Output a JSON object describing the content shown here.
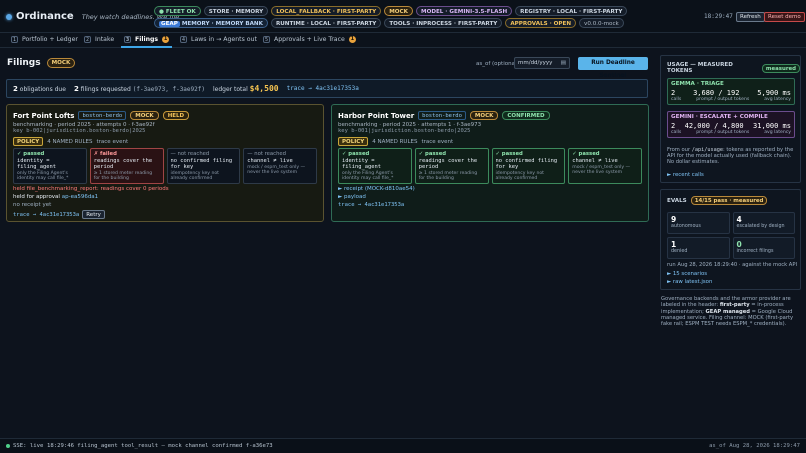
{
  "brand": {
    "name": "Ordinance",
    "tagline": "They watch deadlines. We file."
  },
  "chips_row1": [
    {
      "label": "● FLEET OK",
      "kind": "ok"
    },
    {
      "label": "STORE · MEMORY",
      "kind": "plain"
    },
    {
      "label": "LOCAL_FALLBACK · FIRST-PARTY",
      "kind": "warn"
    },
    {
      "label": "MOCK",
      "kind": "mock"
    },
    {
      "label": "MODEL · GEMINI-3.5-FLASH",
      "kind": "model"
    },
    {
      "label": "REGISTRY · LOCAL · FIRST-PARTY",
      "kind": "plain"
    }
  ],
  "chips_row2": [
    {
      "label": "MEMORY · MEMORY BANK",
      "prefix": "GEAP",
      "kind": "geap"
    },
    {
      "label": "RUNTIME · LOCAL · FIRST-PARTY",
      "kind": "plain"
    },
    {
      "label": "TOOLS · INPROCESS · FIRST-PARTY",
      "kind": "plain"
    },
    {
      "label": "APPROVALS · OPEN",
      "kind": "warn"
    },
    {
      "label": "v0.0.0-mock",
      "kind": "ver"
    }
  ],
  "header": {
    "clock": "18:29:47",
    "refresh_label": "Refresh",
    "reset_label": "Reset demo"
  },
  "tabs": [
    {
      "num": "1",
      "label": "Portfolio + Ledger",
      "badge": ""
    },
    {
      "num": "2",
      "label": "Intake",
      "badge": ""
    },
    {
      "num": "3",
      "label": "Filings",
      "badge": "1",
      "active": true
    },
    {
      "num": "4",
      "label": "Laws in → Agents out",
      "badge": ""
    },
    {
      "num": "5",
      "label": "Approvals + Live Trace",
      "badge": "1"
    }
  ],
  "filings": {
    "title": "Filings",
    "mode": "MOCK",
    "asof_label": "as_of (optional)",
    "asof_placeholder": "mm/dd/yyyy",
    "run_label": "Run Deadline Sentinel",
    "summary": {
      "obligations_count": "2",
      "obligations_text": "obligations due",
      "requested_count": "2",
      "requested_text": "filings requested",
      "requested_ids": "(f-3ae973, f-3ae92f)",
      "ledger_label": "ledger total",
      "ledger_total": "$4,500",
      "trace": "trace → 4ac31e17353a"
    }
  },
  "cards": [
    {
      "title": "Fort Point Lofts",
      "city": "boston-berdo",
      "mode": "MOCK",
      "status": "HELD",
      "meta": "benchmarking · period 2025 · attempts 0 · f-3ae92f",
      "key": "key b-002|jurisdiction.boston-berdo|2025",
      "policy": "POLICY",
      "rules_count": "4 NAMED RULES",
      "trace_event": "trace event",
      "rules": [
        {
          "status": "✓ passed",
          "kind": "ok",
          "expr": "identity = filing_agent",
          "note": "only the Filing Agent's identity may call file_*"
        },
        {
          "status": "✗ failed",
          "kind": "fail",
          "expr": "readings cover the period",
          "note": "≥ 1 stored meter reading for the building"
        },
        {
          "status": "— not reached",
          "kind": "nr",
          "expr": "no confirmed filing for key",
          "note": "idempotency key not already confirmed"
        },
        {
          "status": "— not reached",
          "kind": "nr",
          "expr": "channel ≠ live",
          "note": "mock / espm_test only — never the live system"
        }
      ],
      "held_reason": "held file_benchmarking_report: readings cover 0 periods",
      "held_for_prefix": "held for approval",
      "held_for_id": "ap-ea596da1",
      "receipt": "no receipt yet",
      "trace": "trace → 4ac31e17353a",
      "retry_label": "Retry"
    },
    {
      "title": "Harbor Point Tower",
      "city": "boston-berdo",
      "mode": "MOCK",
      "status": "CONFIRMED",
      "meta": "benchmarking · period 2025 · attempts 1 · f-3ae973",
      "key": "key b-001|jurisdiction.boston-berdo|2025",
      "policy": "POLICY",
      "rules_count": "4 NAMED RULES",
      "trace_event": "trace event",
      "rules": [
        {
          "status": "✓ passed",
          "kind": "ok",
          "expr": "identity = filing_agent",
          "note": "only the Filing Agent's identity may call file_*"
        },
        {
          "status": "✓ passed",
          "kind": "ok",
          "expr": "readings cover the period",
          "note": "≥ 1 stored meter reading for the building"
        },
        {
          "status": "✓ passed",
          "kind": "ok",
          "expr": "no confirmed filing for key",
          "note": "idempotency key not already confirmed"
        },
        {
          "status": "✓ passed",
          "kind": "ok",
          "expr": "channel ≠ live",
          "note": "mock / espm_test only — never the live system"
        }
      ],
      "receipt_link": "► receipt (MOCK-d810ae54)",
      "payload_link": "► payload",
      "trace": "trace → 4ac31e17353a"
    }
  ],
  "usage": {
    "title": "USAGE — MEASURED TOKENS",
    "badge": "measured",
    "triage": {
      "name": "GEMMA · TRIAGE",
      "calls": "2",
      "tokens": "3,680 / 192",
      "latency": "5,900 ms",
      "calls_label": "calls",
      "tokens_label": "prompt / output tokens",
      "latency_label": "avg latency"
    },
    "escalate": {
      "name": "GEMINI · ESCALATE + COMPILE",
      "calls": "2",
      "tokens": "42,000 / 4,800",
      "latency": "31,000 ms",
      "calls_label": "calls",
      "tokens_label": "prompt / output tokens",
      "latency_label": "avg latency"
    },
    "note_a": "From our",
    "note_code": "/api/usage",
    "note_b": ": tokens as reported by the API for the model actually used (fallback chain). No dollar estimates.",
    "recent_link": "► recent calls"
  },
  "evals": {
    "title": "EVALS",
    "badge": "14/15 pass · measured",
    "cells": [
      {
        "value": "9",
        "label": "autonomous"
      },
      {
        "value": "4",
        "label": "escalated by design"
      },
      {
        "value": "1",
        "label": "denied"
      },
      {
        "value": "0",
        "label": "incorrect filings"
      }
    ],
    "run_text": "run Aug 28, 2026 18:29:40 · against the mock API",
    "scenarios_link": "► 15 scenarios",
    "raw_link": "► raw latest.json"
  },
  "governance_note": {
    "a": "Governance backends and the armor provider are labeled in the header:",
    "b": "first-party",
    "c": "= in-process implementation;",
    "d": "GEAP managed",
    "e": "= Google Cloud managed service. Filing channel: MOCK (first-party fake rail; ESPM TEST needs ESPM_* credentials)."
  },
  "footer": {
    "sse": "SSE: live",
    "event": "18:29:46 filing_agent tool_result — mock channel confirmed f-a36e73",
    "asof": "as_of Aug 28, 2026 18:29:47"
  }
}
